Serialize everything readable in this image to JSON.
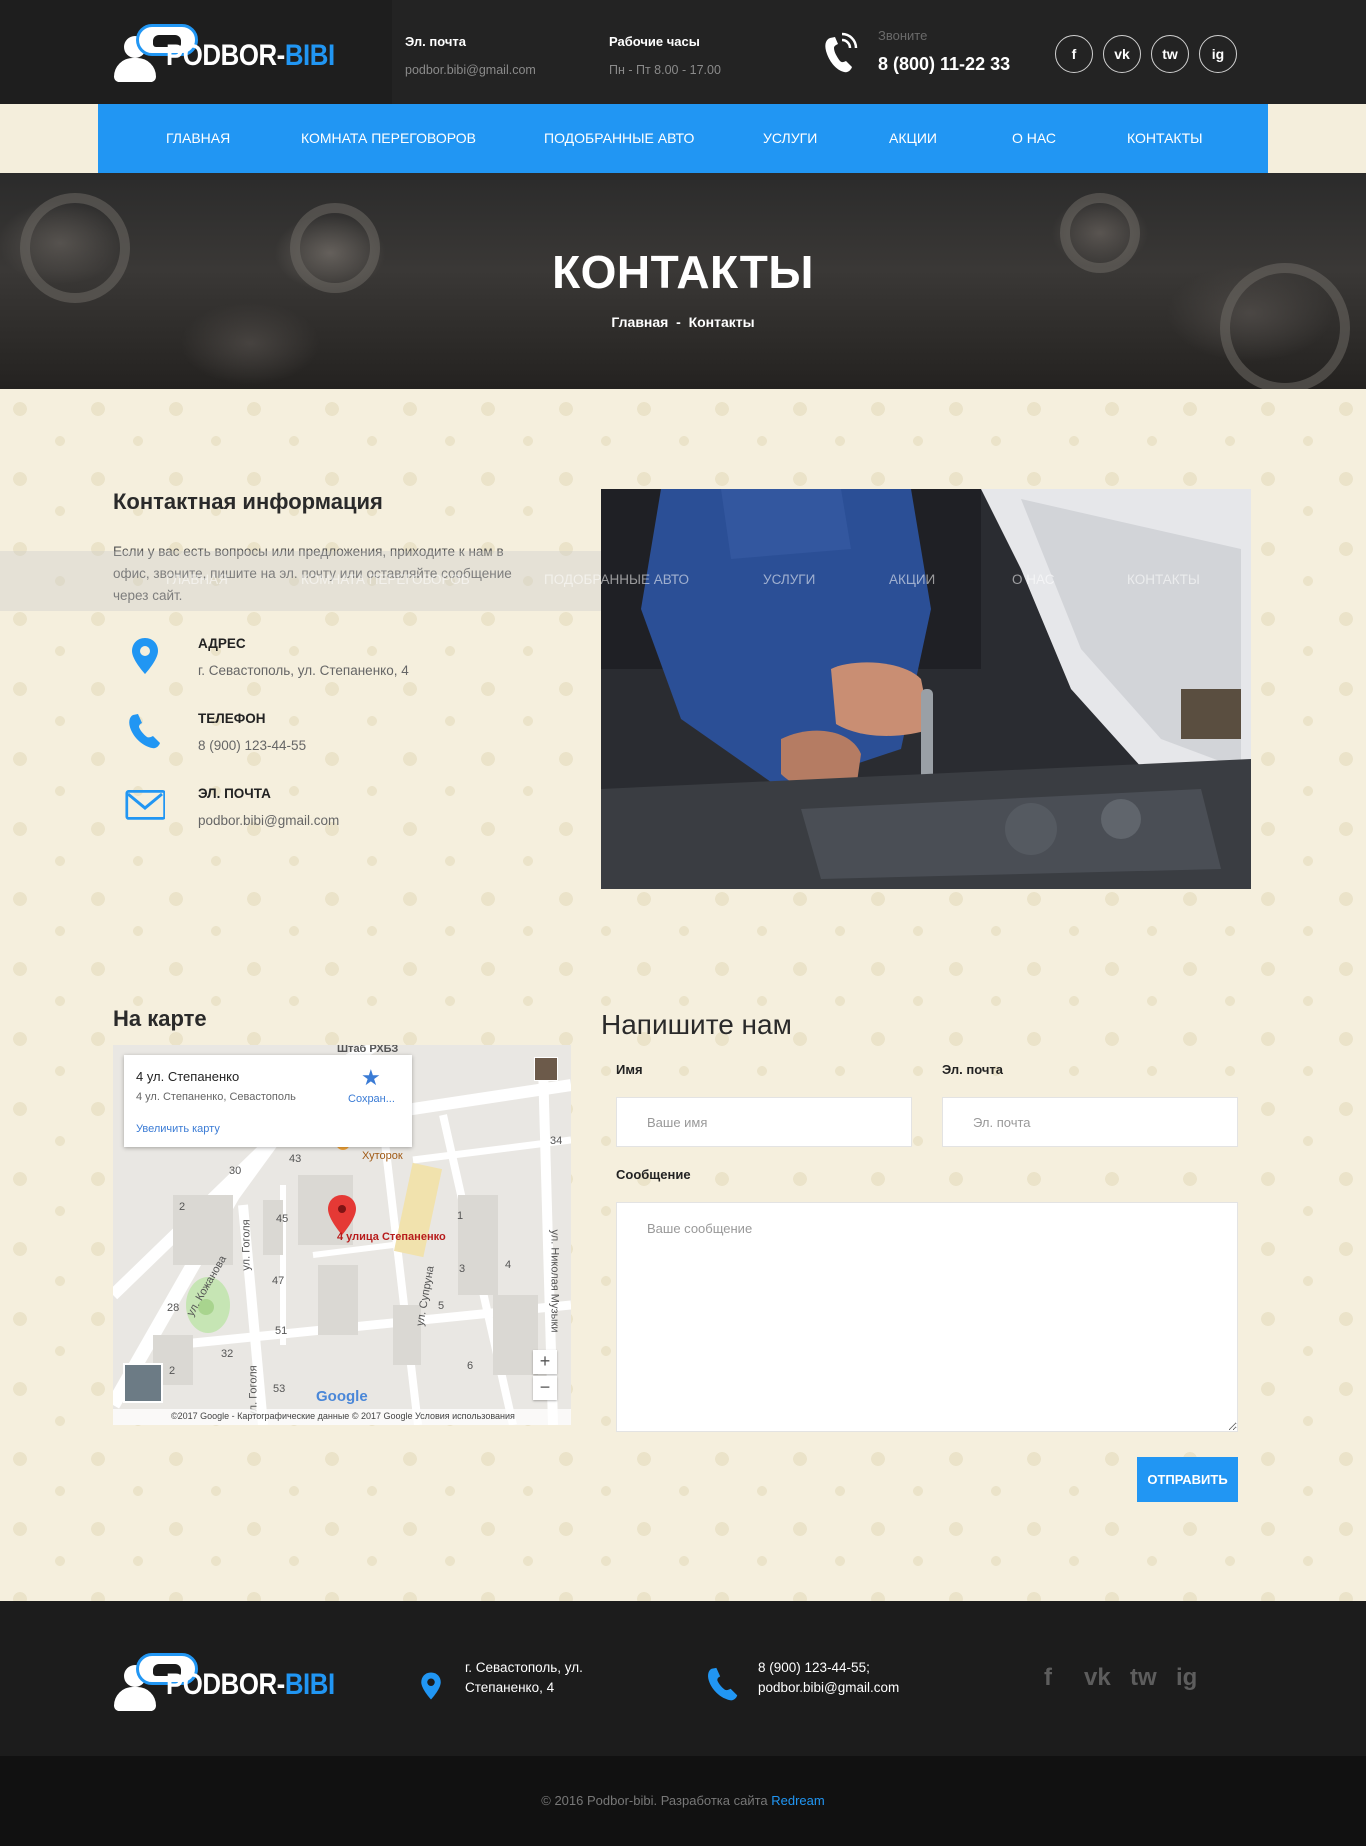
{
  "brand": {
    "name_main": "PODBOR-",
    "name_accent": "BIBI"
  },
  "header": {
    "email_title": "Эл. почта",
    "email_value": "podbor.bibi@gmail.com",
    "hours_title": "Рабочие часы",
    "hours_value": "Пн - Пт 8.00 - 17.00",
    "call_label": "Звоните",
    "call_number": "8 (800) 11-22 33",
    "socials": [
      "f",
      "vk",
      "tw",
      "ig"
    ]
  },
  "nav": {
    "items": [
      {
        "label": "ГЛАВНАЯ"
      },
      {
        "label": "КОМНАТА ПЕРЕГОВОРОВ"
      },
      {
        "label": "ПОДОБРАННЫЕ АВТО"
      },
      {
        "label": "УСЛУГИ"
      },
      {
        "label": "АКЦИИ"
      },
      {
        "label": "О НАС"
      },
      {
        "label": "КОНТАКТЫ"
      }
    ]
  },
  "hero": {
    "title": "КОНТАКТЫ",
    "breadcrumb_home": "Главная",
    "breadcrumb_sep": "-",
    "breadcrumb_current": "Контакты"
  },
  "contact": {
    "title": "Контактная информация",
    "intro": "Если у вас есть вопросы или предложения, приходите к нам в офис, звоните, пишите на эл. почту или оставляйте сообщение через сайт.",
    "items": [
      {
        "label": "АДРЕС",
        "value": "г. Севастополь, ул. Степаненко, 4",
        "icon": "map-pin-icon"
      },
      {
        "label": "ТЕЛЕФОН",
        "value": "8 (900) 123-44-55",
        "icon": "phone-icon"
      },
      {
        "label": "ЭЛ. ПОЧТА",
        "value": "podbor.bibi@gmail.com",
        "icon": "envelope-icon"
      }
    ]
  },
  "map": {
    "title": "На карте",
    "card_name": "4 ул. Степаненко",
    "card_address": "4 ул. Степаненко, Севастополь",
    "card_save": "Сохран...",
    "card_enlarge": "Увеличить карту",
    "pin_label": "4 улица Степаненко",
    "labels": {
      "top": "Штаб РХБЗ",
      "place": "Хуторок",
      "street1": "ул. Кожанова",
      "street2": "ул. Гоголя",
      "street3": "ул. Супруна",
      "street4": "ул. Николая Музыки",
      "street5": "ул. Гоголя",
      "n34": "34",
      "n30": "30",
      "n43": "43",
      "n2a": "2",
      "n45": "45",
      "n47": "47",
      "n1": "1",
      "n3": "3",
      "n4": "4",
      "n5": "5",
      "n6": "6",
      "n51": "51",
      "n53": "53",
      "n32": "32",
      "n2b": "2",
      "n28": "28"
    },
    "zoom_in": "+",
    "zoom_out": "−",
    "google": "Google",
    "footer": "©2017 Google - Картографические данные © 2017 Google     Условия использования"
  },
  "form": {
    "title": "Напишите нам",
    "name_label": "Имя",
    "name_placeholder": "Ваше имя",
    "email_label": "Эл. почта",
    "email_placeholder": "Эл. почта",
    "message_label": "Сообщение",
    "message_placeholder": "Ваше сообщение",
    "submit": "ОТПРАВИТЬ"
  },
  "footer": {
    "address": "г. Севастополь, ул. Степаненко, 4",
    "phone": "8 (900) 123-44-55;",
    "email": "podbor.bibi@gmail.com",
    "socials": [
      "f",
      "vk",
      "tw",
      "ig"
    ],
    "copyright": "© 2016 Podbor-bibi. Разработка сайта ",
    "developer": "Redream"
  },
  "colors": {
    "accent": "#2196f3",
    "header_bg": "#232323",
    "footer_bg": "#1c1c1c",
    "page_bg": "#f5efdd"
  }
}
